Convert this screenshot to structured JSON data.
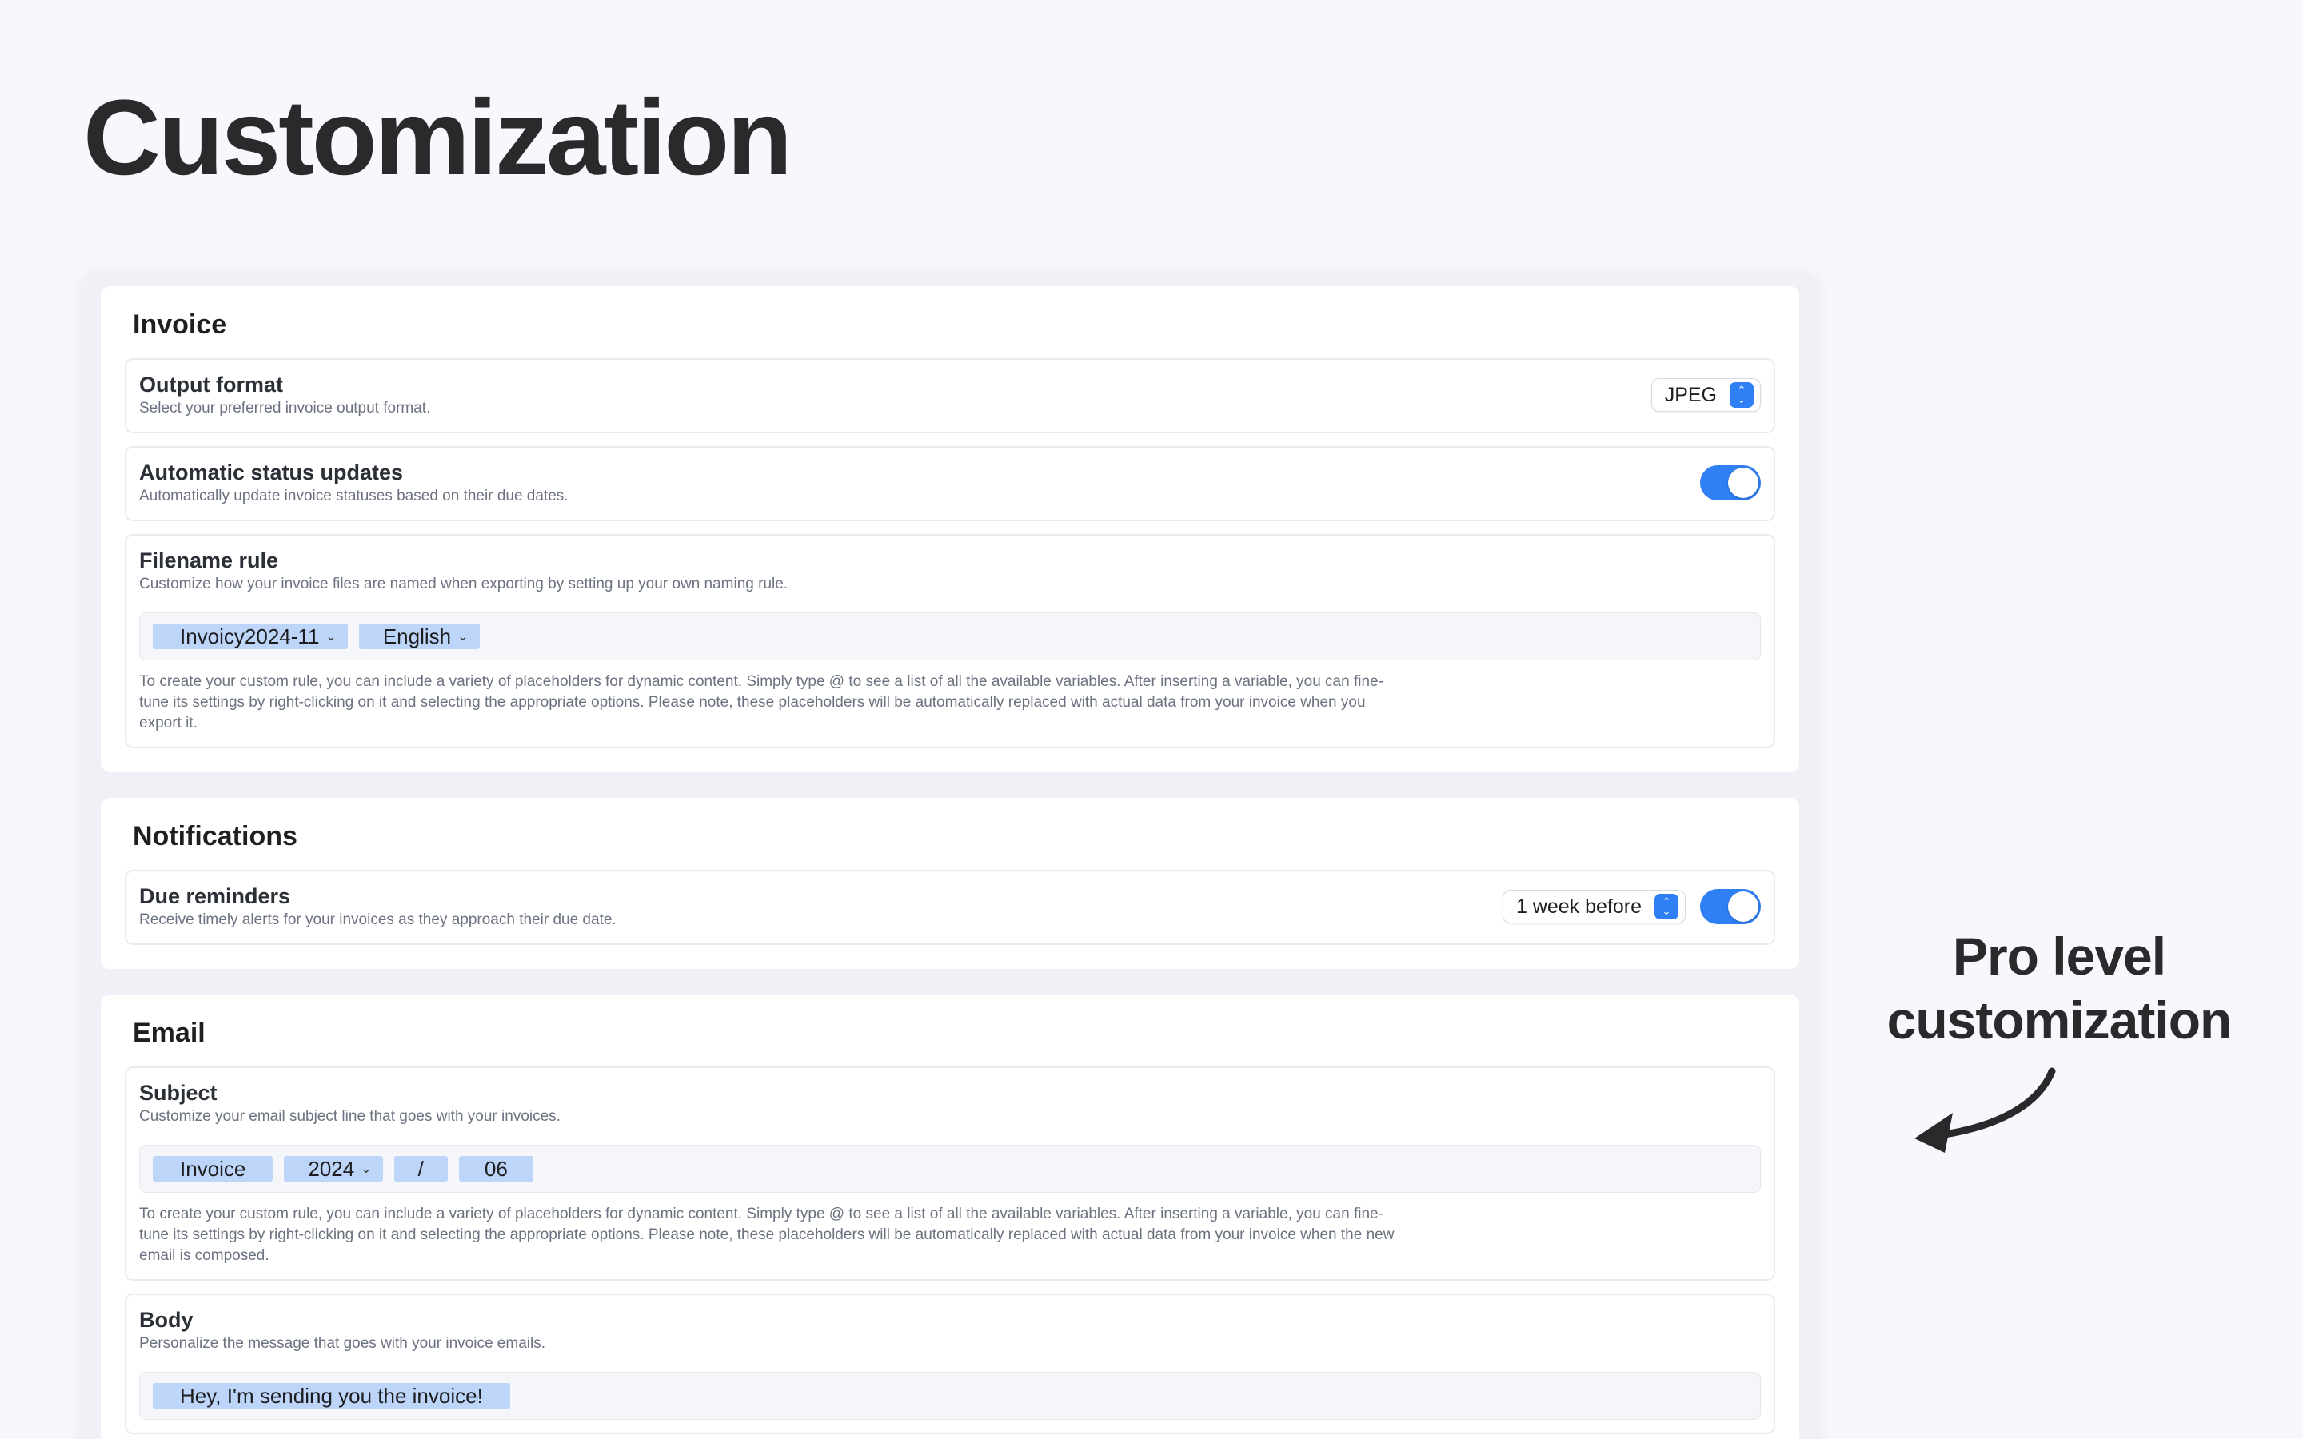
{
  "hero": {
    "title": "Customization"
  },
  "callout": {
    "line1": "Pro level",
    "line2": "customization"
  },
  "invoice": {
    "title": "Invoice",
    "output_format": {
      "title": "Output format",
      "desc": "Select your preferred invoice output format.",
      "value": "JPEG"
    },
    "auto_status": {
      "title": "Automatic status updates",
      "desc": "Automatically update invoice statuses based on their due dates.",
      "enabled": true
    },
    "filename_rule": {
      "title": "Filename rule",
      "desc": "Customize how your invoice files are named when exporting by setting up your own naming rule.",
      "tokens": [
        "Invoicy2024-11",
        "English"
      ],
      "help": "To create your custom rule, you can include a variety of placeholders for dynamic content. Simply type @ to see a list of all the available variables. After inserting a variable, you can fine-tune its settings by right-clicking on it and selecting the appropriate options. Please note, these placeholders will be automatically replaced with actual data from your invoice when you export it."
    }
  },
  "notifications": {
    "title": "Notifications",
    "due_reminders": {
      "title": "Due reminders",
      "desc": "Receive timely alerts for your invoices as they approach their due date.",
      "timing": "1 week before",
      "enabled": true
    }
  },
  "email": {
    "title": "Email",
    "subject": {
      "title": "Subject",
      "desc": "Customize your email subject line that goes with your invoices.",
      "tokens": [
        "Invoice",
        "2024",
        "/",
        "06"
      ],
      "help": "To create your custom rule, you can include a variety of placeholders for dynamic content. Simply type @ to see a list of all the available variables. After inserting a variable, you can fine-tune its settings by right-clicking on it and selecting the appropriate options. Please note, these placeholders will be automatically replaced with actual data from your invoice when the new email is composed."
    },
    "body": {
      "title": "Body",
      "desc": "Personalize the message that goes with your invoice emails.",
      "tokens": [
        "Hey, I'm sending you the invoice!"
      ]
    }
  },
  "colors": {
    "accent": "#2f7ff5",
    "token": "#bcd5f9"
  }
}
